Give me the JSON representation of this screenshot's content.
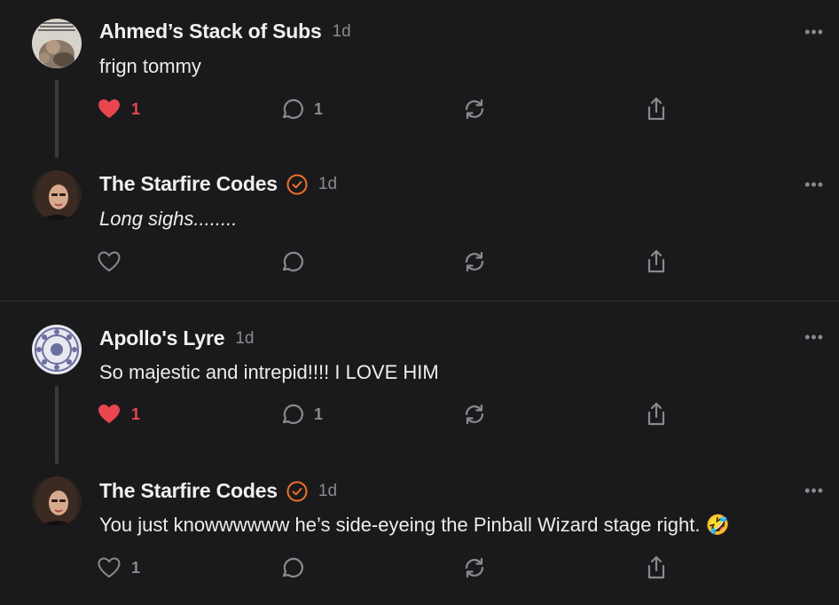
{
  "comments": [
    {
      "author": "Ahmed’s Stack of Subs",
      "time": "1d",
      "text": "frign tommy",
      "italic": false,
      "verified": false,
      "liked": true,
      "likes": "1",
      "replies": "1",
      "avatar": "meme-photo"
    },
    {
      "author": "The Starfire Codes",
      "time": "1d",
      "text": "Long sighs........",
      "italic": true,
      "verified": true,
      "liked": false,
      "likes": "",
      "replies": "",
      "avatar": "woman-portrait"
    },
    {
      "author": "Apollo's Lyre",
      "time": "1d",
      "text": "So majestic and intrepid!!!! I LOVE HIM",
      "italic": false,
      "verified": false,
      "liked": true,
      "likes": "1",
      "replies": "1",
      "avatar": "mandala-pattern"
    },
    {
      "author": "The Starfire Codes",
      "time": "1d",
      "text": "You just knowwwwww he’s side-eyeing the Pinball Wizard stage right. 🤣",
      "italic": false,
      "verified": true,
      "liked": false,
      "likes": "1",
      "replies": "",
      "avatar": "woman-portrait"
    }
  ],
  "more_label": "•••",
  "colors": {
    "background": "#1a1a1c",
    "like_active": "#e8474f",
    "verified": "#f0702a",
    "muted": "#8a8a8e"
  },
  "icons": [
    "heart-icon",
    "comment-icon",
    "restack-icon",
    "share-icon",
    "verified-badge-icon",
    "more-icon"
  ]
}
